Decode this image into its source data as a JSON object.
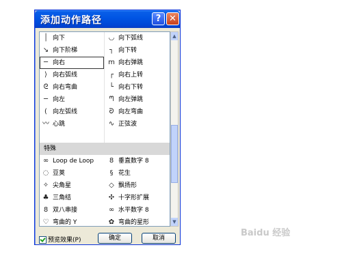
{
  "dialog": {
    "title": "添加动作路径",
    "help_label": "?",
    "close_label": "✕",
    "section_label": "特殊",
    "items_top": [
      {
        "icon": "vertical-line-icon",
        "glyph": "│",
        "label": "向下"
      },
      {
        "icon": "arc-down-icon",
        "glyph": "◡",
        "label": "向下弧线"
      },
      {
        "icon": "diagonal-steps-icon",
        "glyph": "↘",
        "label": "向下阶梯"
      },
      {
        "icon": "turn-down-icon",
        "glyph": "┐",
        "label": "向下转"
      },
      {
        "icon": "horizontal-line-icon",
        "glyph": "─",
        "label": "向右"
      },
      {
        "icon": "bounce-right-icon",
        "glyph": "m",
        "label": "向右弹跳"
      },
      {
        "icon": "arc-right-icon",
        "glyph": "⟩",
        "label": "向右弧线"
      },
      {
        "icon": "turn-up-right-icon",
        "glyph": "┌",
        "label": "向右上转"
      },
      {
        "icon": "curve-right-icon",
        "glyph": "ᘓ",
        "label": "向右弯曲"
      },
      {
        "icon": "turn-down-right-icon",
        "glyph": "└",
        "label": "向右下转"
      },
      {
        "icon": "horizontal-line-left-icon",
        "glyph": "─",
        "label": "向左"
      },
      {
        "icon": "bounce-left-icon",
        "glyph": "ᘉ",
        "label": "向左弹跳"
      },
      {
        "icon": "arc-left-icon",
        "glyph": "(",
        "label": "向左弧线"
      },
      {
        "icon": "curve-left-icon",
        "glyph": "ᘐ",
        "label": "向左弯曲"
      },
      {
        "icon": "heartbeat-icon",
        "glyph": "〰",
        "label": "心跳"
      },
      {
        "icon": "sine-wave-icon",
        "glyph": "∿",
        "label": "正弦波"
      }
    ],
    "items_bottom": [
      {
        "icon": "loop-de-loop-icon",
        "glyph": "∞",
        "label": "Loop de Loop"
      },
      {
        "icon": "figure-eight-vertical-icon",
        "glyph": "8",
        "label": "垂直数字 8"
      },
      {
        "icon": "bean-icon",
        "glyph": "◌",
        "label": "豆荚"
      },
      {
        "icon": "peanut-icon",
        "glyph": "§",
        "label": "花生"
      },
      {
        "icon": "pointy-star-icon",
        "glyph": "✧",
        "label": "尖角星"
      },
      {
        "icon": "diamond-shape-icon",
        "glyph": "◇",
        "label": "飘扬形"
      },
      {
        "icon": "trefoil-knot-icon",
        "glyph": "♣",
        "label": "三角结"
      },
      {
        "icon": "cross-expand-icon",
        "glyph": "✣",
        "label": "十字形扩展"
      },
      {
        "icon": "double-eight-icon",
        "glyph": "8",
        "label": "双八串接"
      },
      {
        "icon": "figure-eight-horizontal-icon",
        "glyph": "∞",
        "label": "水平数字 8"
      },
      {
        "icon": "curved-y-icon",
        "glyph": "♡",
        "label": "弯曲的 Y"
      },
      {
        "icon": "curved-star-icon",
        "glyph": "✿",
        "label": "弯曲的星形"
      }
    ],
    "preview_label": "预览效果(P)",
    "ok_label": "确定",
    "cancel_label": "取消",
    "accent": "#0054e3"
  },
  "watermark": "Baidu 经验"
}
